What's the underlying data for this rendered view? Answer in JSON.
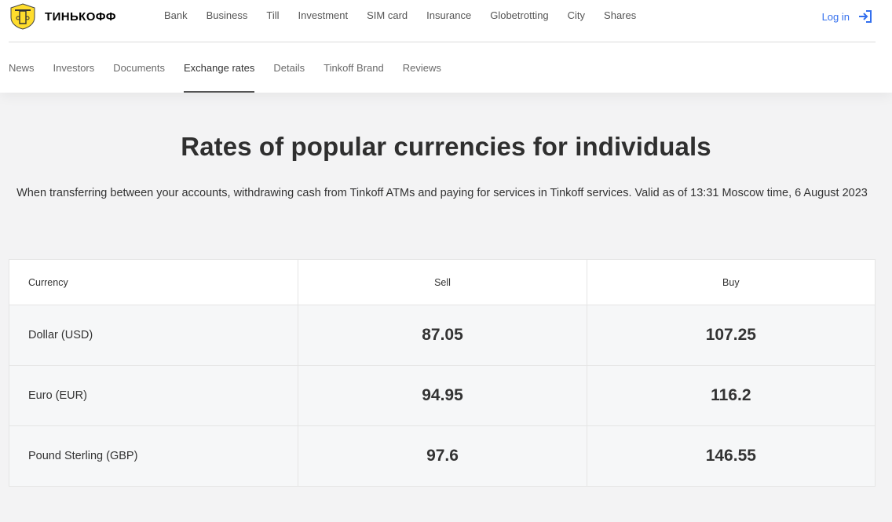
{
  "brand": {
    "name": "ТИНЬКОФФ",
    "accent": "#336fee",
    "emblem_color": "#ffdd2d"
  },
  "main_nav": [
    {
      "label": "Bank"
    },
    {
      "label": "Business"
    },
    {
      "label": "Till"
    },
    {
      "label": "Investment"
    },
    {
      "label": "SIM card"
    },
    {
      "label": "Insurance"
    },
    {
      "label": "Globetrotting"
    },
    {
      "label": "City"
    },
    {
      "label": "Shares"
    }
  ],
  "login": {
    "label": "Log in",
    "icon": "login-arrow-icon"
  },
  "sub_nav": [
    {
      "label": "News"
    },
    {
      "label": "Investors"
    },
    {
      "label": "Documents"
    },
    {
      "label": "Exchange rates",
      "active": true
    },
    {
      "label": "Details"
    },
    {
      "label": "Tinkoff Brand"
    },
    {
      "label": "Reviews"
    }
  ],
  "page": {
    "title": "Rates of popular currencies for individuals",
    "description": "When transferring between your accounts, withdrawing cash from Tinkoff ATMs and paying for services in Tinkoff services. Valid as of 13:31 Moscow time, 6 August 2023"
  },
  "rates_table": {
    "columns": [
      "Currency",
      "Sell",
      "Buy"
    ],
    "rows": [
      {
        "currency": "Dollar (USD)",
        "sell": "87.05",
        "buy": "107.25"
      },
      {
        "currency": "Euro (EUR)",
        "sell": "94.95",
        "buy": "116.2"
      },
      {
        "currency": "Pound Sterling (GBP)",
        "sell": "97.6",
        "buy": "146.55"
      }
    ]
  }
}
